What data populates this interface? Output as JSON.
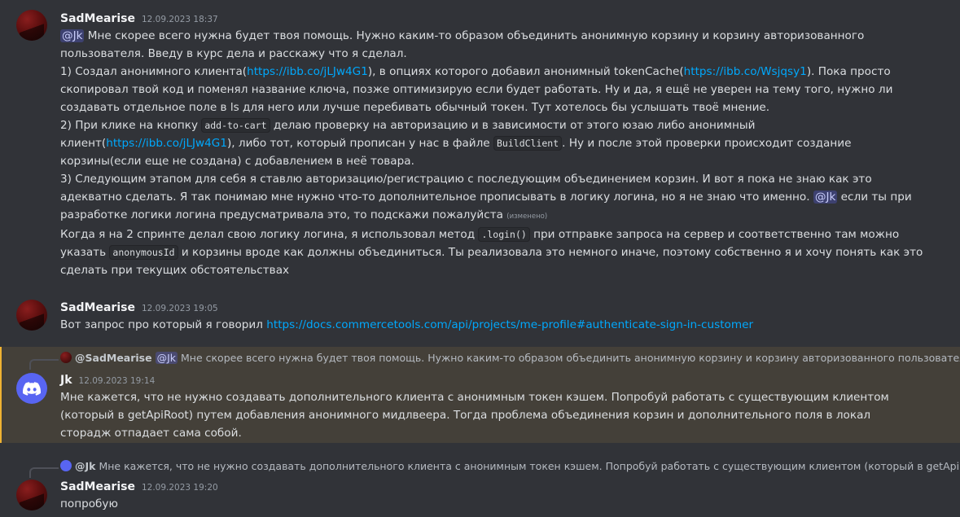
{
  "messages": [
    {
      "author": "SadMearise",
      "timestamp": "12.09.2023 18:37",
      "paragraphs": [
        {
          "parts": [
            {
              "t": "mention",
              "v": "@Jk"
            },
            {
              "t": "text",
              "v": " Мне скорее всего нужна будет твоя помощь. Нужно каким-то образом объединить анонимную корзину и корзину авторизованного пользователя. Введу в курс дела и расскажу что я сделал."
            }
          ]
        },
        {
          "parts": [
            {
              "t": "text",
              "v": "1) Создал анонимного клиента("
            },
            {
              "t": "link",
              "v": "https://ibb.co/jLJw4G1"
            },
            {
              "t": "text",
              "v": "), в опциях которого добавил анонимный tokenCache("
            },
            {
              "t": "link",
              "v": "https://ibb.co/Wsjqsy1"
            },
            {
              "t": "text",
              "v": "). Пока просто скопировал твой код и поменял название ключа, позже оптимизирую если будет работать. Ну и да, я ещё не уверен на тему того, нужно ли создавать отдельное поле в ls для него или лучше перебивать обычный токен. Тут хотелось бы услышать твоё мнение."
            }
          ]
        },
        {
          "parts": [
            {
              "t": "text",
              "v": "2) При клике на кнопку "
            },
            {
              "t": "code",
              "v": "add-to-cart"
            },
            {
              "t": "text",
              "v": " делаю проверку на авторизацию и в зависимости от этого юзаю либо анонимный клиент("
            },
            {
              "t": "link",
              "v": "https://ibb.co/jLJw4G1"
            },
            {
              "t": "text",
              "v": "), либо тот, который прописан у нас в файле "
            },
            {
              "t": "code",
              "v": "BuildClient"
            },
            {
              "t": "text",
              "v": ". Ну и после этой проверки происходит создание корзины(если еще не создана) с добавлением в неё товара."
            }
          ]
        },
        {
          "parts": [
            {
              "t": "text",
              "v": "3) Следующим этапом для себя я ставлю авторизацию/регистрацию с последующим объединением корзин. И вот я пока не знаю как это адекватно сделать. Я так понимаю мне нужно что-то дополнительное прописывать в логику логина, но я не знаю что именно. "
            },
            {
              "t": "mention",
              "v": "@Jk"
            },
            {
              "t": "text",
              "v": " если ты при разработке логики логина предусматривала это, то подскажи пожалуйста "
            },
            {
              "t": "edited",
              "v": "(изменено)"
            }
          ]
        },
        {
          "parts": [
            {
              "t": "text",
              "v": "Когда я на 2 спринте делал свою логику логина, я использовал метод "
            },
            {
              "t": "code",
              "v": ".login()"
            },
            {
              "t": "text",
              "v": " при отправке запроса на сервер и соответственно там можно указать "
            },
            {
              "t": "code",
              "v": "anonymousId"
            },
            {
              "t": "text",
              "v": " и корзины вроде как должны объединиться. Ты реализовала это немного иначе, поэтому собственно я и хочу понять как это сделать при текущих обстоятельствах"
            }
          ]
        }
      ]
    },
    {
      "author": "SadMearise",
      "timestamp": "12.09.2023 19:05",
      "paragraphs": [
        {
          "parts": [
            {
              "t": "text",
              "v": "Вот запрос про который я говорил "
            },
            {
              "t": "link",
              "v": "https://docs.commercetools.com/api/projects/me-profile#authenticate-sign-in-customer"
            }
          ]
        }
      ]
    },
    {
      "author": "Jk",
      "timestamp": "12.09.2023 19:14",
      "reply": {
        "user": "@SadMearise",
        "mention": "@Jk",
        "text": " Мне скорее всего нужна будет твоя помощь. Нужно каким-то образом объединить анонимную корзину и корзину авторизованного пользователя. Вв"
      },
      "paragraphs": [
        {
          "parts": [
            {
              "t": "text",
              "v": "Мне кажется, что не нужно создавать дополнительного клиента с анонимным токен кэшем. Попробуй работать с существующим клиентом (который в getApiRoot) путем добавления анонимного мидлвеера. Тогда проблема объединения корзин и дополнительного поля в локал сторадж отпадает сама собой."
            }
          ]
        }
      ]
    },
    {
      "author": "SadMearise",
      "timestamp": "12.09.2023 19:20",
      "reply": {
        "user": "@Jk",
        "mention": "",
        "text": " Мне кажется, что не нужно создавать дополнительного клиента с анонимным токен кэшем. Попробуй работать с существующим клиентом (который в getApiRoot)"
      },
      "paragraphs": [
        {
          "parts": [
            {
              "t": "text",
              "v": "попробую"
            }
          ]
        }
      ]
    }
  ]
}
